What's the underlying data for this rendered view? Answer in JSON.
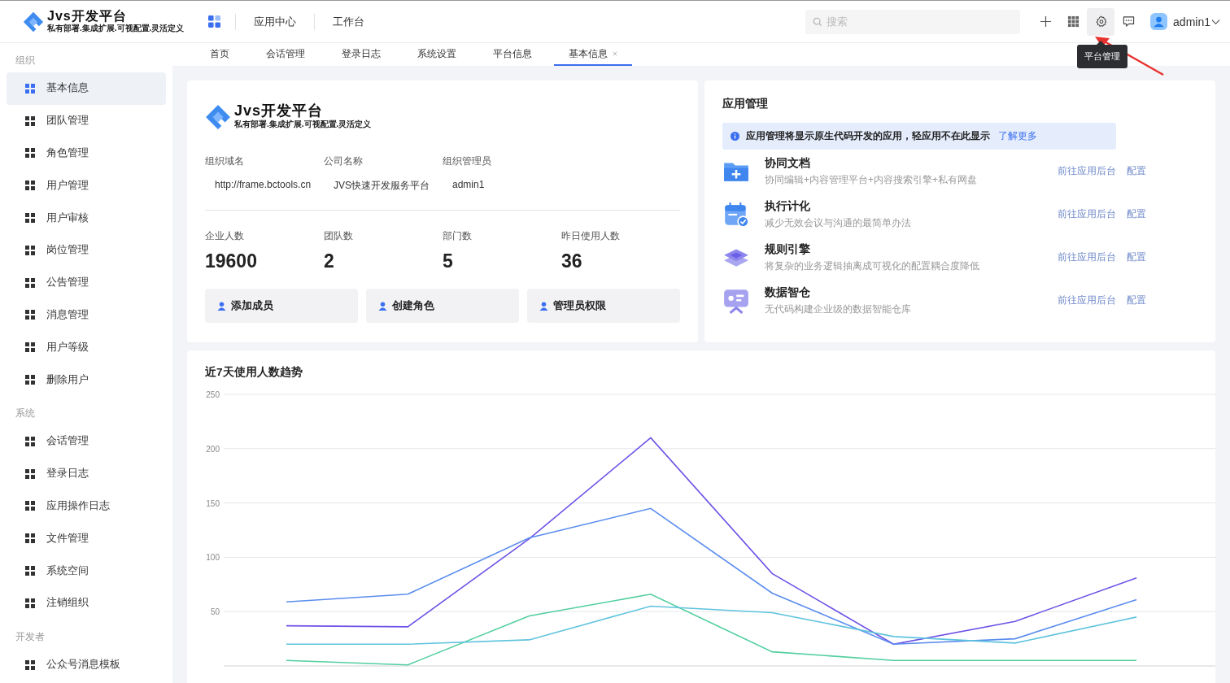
{
  "header": {
    "logo": {
      "name": "Jvs开发平台",
      "tagline": "私有部署.集成扩展.可视配置.灵活定义"
    },
    "nav": [
      {
        "label": "应用中心"
      },
      {
        "label": "工作台"
      }
    ],
    "search": {
      "placeholder": "搜索"
    },
    "toolbar": [
      {
        "kind": "add",
        "active": false
      },
      {
        "kind": "apps",
        "active": false
      },
      {
        "kind": "settings",
        "active": true
      },
      {
        "kind": "messages",
        "active": false
      }
    ],
    "tooltip": "平台管理",
    "user": "admin1"
  },
  "tabs": [
    {
      "label": "首页",
      "selected": false,
      "closable": false
    },
    {
      "label": "会话管理",
      "selected": false,
      "closable": false
    },
    {
      "label": "登录日志",
      "selected": false,
      "closable": false
    },
    {
      "label": "系统设置",
      "selected": false,
      "closable": false
    },
    {
      "label": "平台信息",
      "selected": false,
      "closable": false
    },
    {
      "label": "基本信息",
      "selected": true,
      "closable": true
    }
  ],
  "sidebar": {
    "groups": [
      {
        "title": "组织",
        "items": [
          {
            "label": "基本信息",
            "selected": true
          },
          {
            "label": "团队管理",
            "selected": false
          },
          {
            "label": "角色管理",
            "selected": false
          },
          {
            "label": "用户管理",
            "selected": false
          },
          {
            "label": "用户审核",
            "selected": false
          },
          {
            "label": "岗位管理",
            "selected": false
          },
          {
            "label": "公告管理",
            "selected": false
          },
          {
            "label": "消息管理",
            "selected": false
          },
          {
            "label": "用户等级",
            "selected": false
          },
          {
            "label": "删除用户",
            "selected": false
          }
        ]
      },
      {
        "title": "系统",
        "items": [
          {
            "label": "会话管理",
            "selected": false
          },
          {
            "label": "登录日志",
            "selected": false
          },
          {
            "label": "应用操作日志",
            "selected": false
          },
          {
            "label": "文件管理",
            "selected": false
          },
          {
            "label": "系统空间",
            "selected": false
          },
          {
            "label": "注销组织",
            "selected": false
          }
        ]
      },
      {
        "title": "开发者",
        "items": [
          {
            "label": "公众号消息模板",
            "selected": false
          }
        ]
      }
    ]
  },
  "org_card": {
    "logo": {
      "name": "Jvs开发平台",
      "tagline": "私有部署.集成扩展.可视配置.灵活定义"
    },
    "fields": [
      {
        "label": "组织域名",
        "value": "http://frame.bctools.cn"
      },
      {
        "label": "公司名称",
        "value": "JVS快速开发服务平台"
      },
      {
        "label": "组织管理员",
        "value": "admin1"
      }
    ],
    "stats": [
      {
        "label": "企业人数",
        "value": "19600"
      },
      {
        "label": "团队数",
        "value": "2"
      },
      {
        "label": "部门数",
        "value": "5"
      },
      {
        "label": "昨日使用人数",
        "value": "36"
      }
    ],
    "actions": [
      "添加成员",
      "创建角色",
      "管理员权限"
    ]
  },
  "apps_card": {
    "title": "应用管理",
    "notice": {
      "text": "应用管理将显示原生代码开发的应用，轻应用不在此显示",
      "link": "了解更多"
    },
    "apps": [
      {
        "kind": "docs",
        "name": "协同文档",
        "description": "协同编辑+内容管理平台+内容搜索引擎+私有网盘",
        "links": [
          "前往应用后台",
          "配置"
        ]
      },
      {
        "kind": "plan",
        "name": "执行计化",
        "description": "减少无效会议与沟通的最简单办法",
        "links": [
          "前往应用后台",
          "配置"
        ]
      },
      {
        "kind": "rules",
        "name": "规则引擎",
        "description": "将复杂的业务逻辑抽离成可视化的配置耦合度降低",
        "links": [
          "前往应用后台",
          "配置"
        ]
      },
      {
        "kind": "data",
        "name": "数据智仓",
        "description": "无代码构建企业级的数据智能仓库",
        "links": [
          "前往应用后台",
          "配置"
        ]
      }
    ]
  },
  "trend_card": {
    "chart_data": {
      "type": "line",
      "title": "近7天使用人数趋势",
      "ylim": [
        0,
        250
      ],
      "grid": true,
      "yticks": [
        50,
        100,
        150,
        200,
        250
      ],
      "series": [
        {
          "color": "#6f52e6",
          "values": [
            37,
            36,
            117,
            210,
            85,
            20,
            41,
            81
          ]
        },
        {
          "color": "#5b8def",
          "values": [
            59,
            66,
            118,
            145,
            67,
            20,
            25,
            61
          ]
        },
        {
          "color": "#52cf9f",
          "values": [
            5,
            1,
            46,
            66,
            13,
            5,
            5,
            5
          ]
        },
        {
          "color": "#5fc3dd",
          "values": [
            20,
            20,
            24,
            55,
            49,
            27,
            21,
            45
          ]
        }
      ]
    }
  }
}
